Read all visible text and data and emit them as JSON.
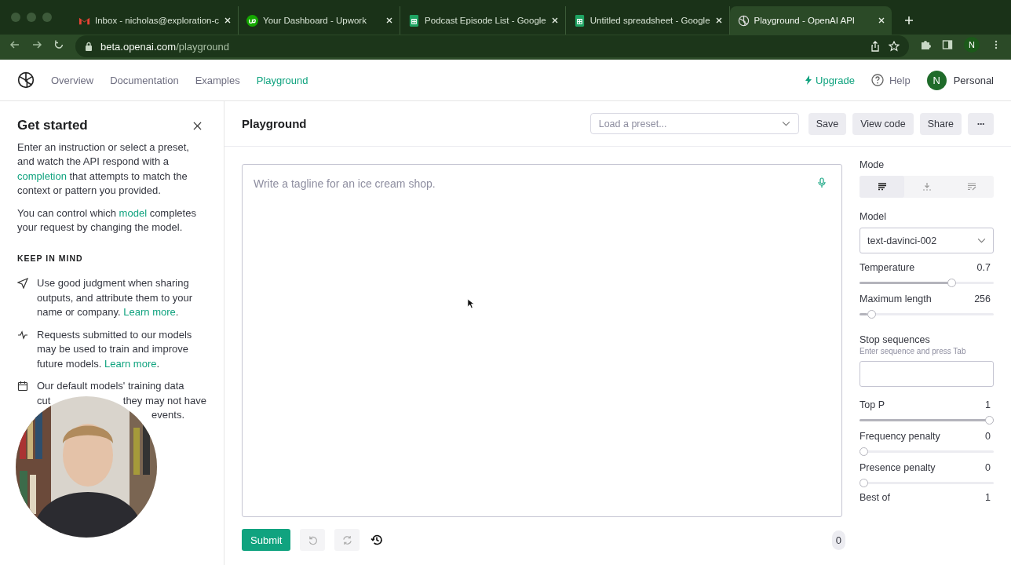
{
  "browser": {
    "tabs": [
      {
        "kind": "gmail",
        "title": "Inbox - nicholas@exploration-c",
        "selected": false
      },
      {
        "kind": "upwork",
        "title": "Your Dashboard - Upwork",
        "selected": false
      },
      {
        "kind": "sheets",
        "title": "Podcast Episode List - Google",
        "selected": false
      },
      {
        "kind": "sheets",
        "title": "Untitled spreadsheet - Google",
        "selected": false
      },
      {
        "kind": "openai",
        "title": "Playground - OpenAI API",
        "selected": true
      }
    ],
    "url_host": "beta.openai.com",
    "url_path": "/playground",
    "profile_initial": "N"
  },
  "nav": {
    "links": [
      {
        "label": "Overview",
        "selected": false
      },
      {
        "label": "Documentation",
        "selected": false
      },
      {
        "label": "Examples",
        "selected": false
      },
      {
        "label": "Playground",
        "selected": true
      }
    ],
    "upgrade": "Upgrade",
    "help": "Help",
    "avatar_initial": "N",
    "account": "Personal"
  },
  "sidebar": {
    "title": "Get started",
    "paragraphs": [
      {
        "before": "Enter an instruction or select a preset, and watch the API respond with a",
        "link": "completion",
        "after": "that attempts to match the context or pattern you provided."
      },
      {
        "before": "You can control which",
        "link": "model",
        "after": "completes your request by changing the model."
      }
    ],
    "section_heading": "KEEP IN MIND",
    "tips": [
      {
        "kind": "send",
        "text": "Use good judgment when sharing outputs, and attribute them to your name or company.",
        "link": "Learn more",
        "after": "."
      },
      {
        "kind": "activity",
        "text": "Requests submitted to our models may be used to train and improve future models.",
        "link": "Learn more",
        "after": "."
      }
    ],
    "partial_tip": {
      "kind": "calendar",
      "line_1": "Our default models' training data",
      "line_2_start": "cut",
      "line_2_end": "they may not have",
      "line_3_end": "events."
    }
  },
  "header": {
    "title": "Playground",
    "preset_placeholder": "Load a preset...",
    "buttons": [
      "Save",
      "View code",
      "Share"
    ],
    "more": "···"
  },
  "editor": {
    "placeholder": "Write a tagline for an ice cream shop.",
    "submit": "Submit",
    "token_count": "0"
  },
  "settings": {
    "mode_label": "Mode",
    "modes": [
      {
        "kind": "complete",
        "selected": true
      },
      {
        "kind": "insert",
        "selected": false
      },
      {
        "kind": "edit",
        "selected": false
      }
    ],
    "model_label": "Model",
    "model": "text-davinci-002",
    "sliders": [
      {
        "name": "Temperature",
        "reading": "0.7",
        "level": 0.7
      },
      {
        "name": "Maximum length",
        "reading": "256",
        "level": 0.06
      }
    ],
    "stop_label": "Stop sequences",
    "stop_hint": "Enter sequence and press Tab",
    "sliders_2": [
      {
        "name": "Top P",
        "reading": "1",
        "level": 1
      },
      {
        "name": "Frequency penalty",
        "reading": "0",
        "level": 0
      },
      {
        "name": "Presence penalty",
        "reading": "0",
        "level": 0
      }
    ],
    "best_of": {
      "name": "Best of",
      "reading": "1"
    }
  }
}
